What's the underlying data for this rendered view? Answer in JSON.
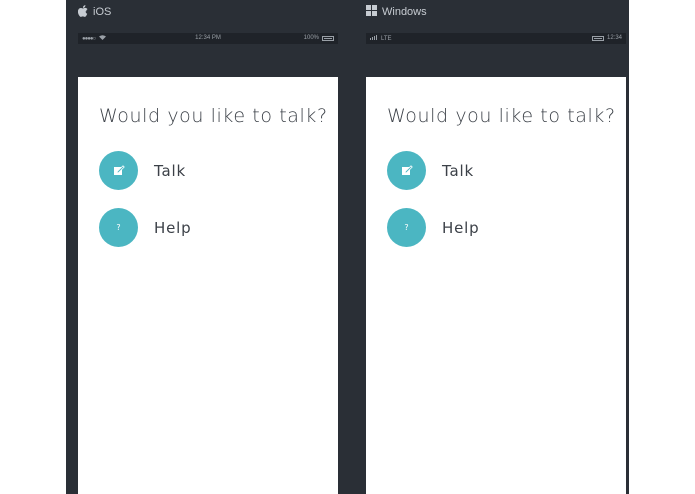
{
  "platforms": [
    {
      "name": "iOS",
      "icon": "apple-icon",
      "statusbar": {
        "left_signal": "●●●●○",
        "center_time": "12:34 PM",
        "right_battery_text": "100%"
      },
      "screen": {
        "question": "Would you like to talk?",
        "actions": [
          {
            "label": "Talk",
            "icon": "compose-icon"
          },
          {
            "label": "Help",
            "icon": "question-icon",
            "glyph": "?"
          }
        ]
      }
    },
    {
      "name": "Windows",
      "icon": "windows-icon",
      "statusbar": {
        "left_network": "LTE",
        "right_time": "12:34"
      },
      "screen": {
        "question": "Would you like to talk?",
        "actions": [
          {
            "label": "Talk",
            "icon": "compose-icon"
          },
          {
            "label": "Help",
            "icon": "question-icon",
            "glyph": "?"
          }
        ]
      }
    }
  ],
  "colors": {
    "background": "#2a2f36",
    "statusbar": "#1f2329",
    "accent": "#4bb6c2",
    "text": "#3c4148",
    "content": "#ffffff"
  }
}
